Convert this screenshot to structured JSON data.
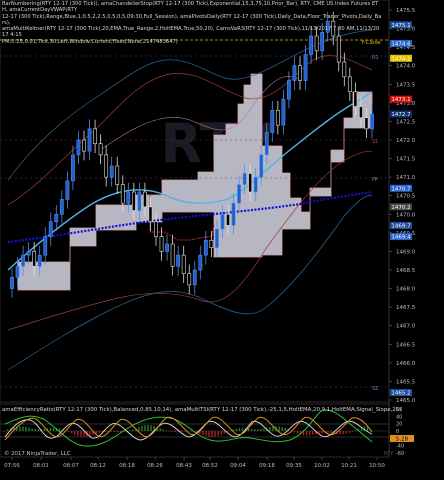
{
  "header": {
    "line1": "BarNumbering(RTY 12-17 (300 Tick)), amaChandelierStop(RTY 12-17 (300 Tick),Exponential,15,3,75,10,Prior_Bar), RTY, CME US Index Futures ETH, amaCurrentDayVWAP(RTY",
    "line2": "12-17 (300 Tick),Range,Blue,1,0.5,2,2.5,0,5,0,5,09:30,Full_Session), amaPivotsDaily(RTY 12-17 (300 Tick),Daily_Data,Floor_Trader_Pivots,Daily_Bars),",
    "line3": "amaMultiKeltner(RTY 12-17 (300 Tick),20,EMA,True_Range,2,HoltEMA,True,50,20), CamsVaR3(RTY 12-17 (300 Tick),11/13/2017 7:30 AM,11/13/2017 4:15",
    "line4": "PM,0.25,0.01,Tick,30,Left,Window,Current,Fixed,None,2147483647)"
  },
  "price_axis": {
    "ticks": [
      "1475.5",
      "1475.0",
      "1474.5",
      "1474.0",
      "1473.5",
      "1473.0",
      "1472.5",
      "1472.0",
      "1471.5",
      "1471.0",
      "1470.5",
      "1470.0",
      "1469.5",
      "1469.0",
      "1468.5",
      "1468.0",
      "1467.5",
      "1467.0",
      "1466.5",
      "1466.0",
      "1465.5",
      "1465.0"
    ],
    "highlights": [
      {
        "text": "1475.1",
        "color": "#1f4f9e"
      },
      {
        "text": "1474.6",
        "color": "#2a63c9"
      },
      {
        "text": "1474.2",
        "color": "#e0c000"
      },
      {
        "text": "1473.1",
        "color": "#d01010"
      },
      {
        "text": "1472.7",
        "color": "#0f2f6e"
      },
      {
        "text": "1470.7",
        "color": "#2a63c9"
      },
      {
        "text": "1470.2",
        "color": "#4a4a4a"
      },
      {
        "text": "1469.7",
        "color": "#1f4f9e"
      },
      {
        "text": "1469.4",
        "color": "#2a63c9"
      },
      {
        "text": "1465.2",
        "color": "#1f4f9e"
      }
    ]
  },
  "level_labels": {
    "y_close": "Y-Close",
    "r1": "R1",
    "s1": "S1",
    "pp": "PP",
    "s2": "S2",
    "cpr": "CPR"
  },
  "watermark_text": "RTY",
  "indicator": {
    "title": "amaEfficiencyRatio(RTY 12-17 (300 Tick),Balanced,0.85,10,14), amaMultiTSI(RTY 12-17 (300 Tick),-25,1,5,HoltEMA,20,9,1,HoltEMA,Signal_Slope,25)",
    "axis_ticks": [
      "60",
      "40",
      "20",
      "0",
      "-20",
      "-40",
      "-60"
    ],
    "value_badge": "5.28",
    "value_badge_color": "#e09020"
  },
  "time_axis": {
    "labels": [
      "07:56",
      "08:01",
      "08:07",
      "08:12",
      "08:18",
      "08:26",
      "08:43",
      "08:52",
      "09:04",
      "09:18",
      "09:35",
      "10:02",
      "10:21",
      "10:50"
    ]
  },
  "footer": {
    "copyright": "© 2017 NinjaTrader, LLC",
    "sponsor": "RTY"
  },
  "colors": {
    "background": "#000000",
    "up_candle": "#1f5fd0",
    "down_candle": "#000000",
    "value_area": "#b7b7c4",
    "vwap": "#1010d8",
    "keltner_mid": "#4fb3e6",
    "chandelier": "#d02020",
    "close_line": "#e0c000"
  }
}
